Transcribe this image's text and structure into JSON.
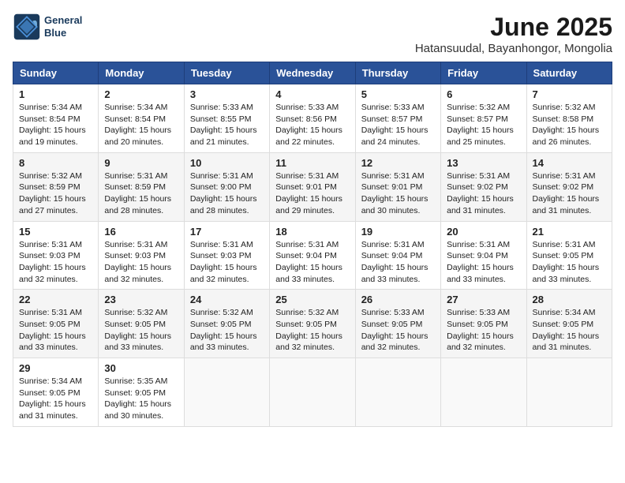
{
  "logo": {
    "line1": "General",
    "line2": "Blue"
  },
  "title": "June 2025",
  "subtitle": "Hatansuudal, Bayanhongor, Mongolia",
  "headers": [
    "Sunday",
    "Monday",
    "Tuesday",
    "Wednesday",
    "Thursday",
    "Friday",
    "Saturday"
  ],
  "weeks": [
    [
      {
        "day": "1",
        "sunrise": "Sunrise: 5:34 AM",
        "sunset": "Sunset: 8:54 PM",
        "daylight": "Daylight: 15 hours and 19 minutes."
      },
      {
        "day": "2",
        "sunrise": "Sunrise: 5:34 AM",
        "sunset": "Sunset: 8:54 PM",
        "daylight": "Daylight: 15 hours and 20 minutes."
      },
      {
        "day": "3",
        "sunrise": "Sunrise: 5:33 AM",
        "sunset": "Sunset: 8:55 PM",
        "daylight": "Daylight: 15 hours and 21 minutes."
      },
      {
        "day": "4",
        "sunrise": "Sunrise: 5:33 AM",
        "sunset": "Sunset: 8:56 PM",
        "daylight": "Daylight: 15 hours and 22 minutes."
      },
      {
        "day": "5",
        "sunrise": "Sunrise: 5:33 AM",
        "sunset": "Sunset: 8:57 PM",
        "daylight": "Daylight: 15 hours and 24 minutes."
      },
      {
        "day": "6",
        "sunrise": "Sunrise: 5:32 AM",
        "sunset": "Sunset: 8:57 PM",
        "daylight": "Daylight: 15 hours and 25 minutes."
      },
      {
        "day": "7",
        "sunrise": "Sunrise: 5:32 AM",
        "sunset": "Sunset: 8:58 PM",
        "daylight": "Daylight: 15 hours and 26 minutes."
      }
    ],
    [
      {
        "day": "8",
        "sunrise": "Sunrise: 5:32 AM",
        "sunset": "Sunset: 8:59 PM",
        "daylight": "Daylight: 15 hours and 27 minutes."
      },
      {
        "day": "9",
        "sunrise": "Sunrise: 5:31 AM",
        "sunset": "Sunset: 8:59 PM",
        "daylight": "Daylight: 15 hours and 28 minutes."
      },
      {
        "day": "10",
        "sunrise": "Sunrise: 5:31 AM",
        "sunset": "Sunset: 9:00 PM",
        "daylight": "Daylight: 15 hours and 28 minutes."
      },
      {
        "day": "11",
        "sunrise": "Sunrise: 5:31 AM",
        "sunset": "Sunset: 9:01 PM",
        "daylight": "Daylight: 15 hours and 29 minutes."
      },
      {
        "day": "12",
        "sunrise": "Sunrise: 5:31 AM",
        "sunset": "Sunset: 9:01 PM",
        "daylight": "Daylight: 15 hours and 30 minutes."
      },
      {
        "day": "13",
        "sunrise": "Sunrise: 5:31 AM",
        "sunset": "Sunset: 9:02 PM",
        "daylight": "Daylight: 15 hours and 31 minutes."
      },
      {
        "day": "14",
        "sunrise": "Sunrise: 5:31 AM",
        "sunset": "Sunset: 9:02 PM",
        "daylight": "Daylight: 15 hours and 31 minutes."
      }
    ],
    [
      {
        "day": "15",
        "sunrise": "Sunrise: 5:31 AM",
        "sunset": "Sunset: 9:03 PM",
        "daylight": "Daylight: 15 hours and 32 minutes."
      },
      {
        "day": "16",
        "sunrise": "Sunrise: 5:31 AM",
        "sunset": "Sunset: 9:03 PM",
        "daylight": "Daylight: 15 hours and 32 minutes."
      },
      {
        "day": "17",
        "sunrise": "Sunrise: 5:31 AM",
        "sunset": "Sunset: 9:03 PM",
        "daylight": "Daylight: 15 hours and 32 minutes."
      },
      {
        "day": "18",
        "sunrise": "Sunrise: 5:31 AM",
        "sunset": "Sunset: 9:04 PM",
        "daylight": "Daylight: 15 hours and 33 minutes."
      },
      {
        "day": "19",
        "sunrise": "Sunrise: 5:31 AM",
        "sunset": "Sunset: 9:04 PM",
        "daylight": "Daylight: 15 hours and 33 minutes."
      },
      {
        "day": "20",
        "sunrise": "Sunrise: 5:31 AM",
        "sunset": "Sunset: 9:04 PM",
        "daylight": "Daylight: 15 hours and 33 minutes."
      },
      {
        "day": "21",
        "sunrise": "Sunrise: 5:31 AM",
        "sunset": "Sunset: 9:05 PM",
        "daylight": "Daylight: 15 hours and 33 minutes."
      }
    ],
    [
      {
        "day": "22",
        "sunrise": "Sunrise: 5:31 AM",
        "sunset": "Sunset: 9:05 PM",
        "daylight": "Daylight: 15 hours and 33 minutes."
      },
      {
        "day": "23",
        "sunrise": "Sunrise: 5:32 AM",
        "sunset": "Sunset: 9:05 PM",
        "daylight": "Daylight: 15 hours and 33 minutes."
      },
      {
        "day": "24",
        "sunrise": "Sunrise: 5:32 AM",
        "sunset": "Sunset: 9:05 PM",
        "daylight": "Daylight: 15 hours and 33 minutes."
      },
      {
        "day": "25",
        "sunrise": "Sunrise: 5:32 AM",
        "sunset": "Sunset: 9:05 PM",
        "daylight": "Daylight: 15 hours and 32 minutes."
      },
      {
        "day": "26",
        "sunrise": "Sunrise: 5:33 AM",
        "sunset": "Sunset: 9:05 PM",
        "daylight": "Daylight: 15 hours and 32 minutes."
      },
      {
        "day": "27",
        "sunrise": "Sunrise: 5:33 AM",
        "sunset": "Sunset: 9:05 PM",
        "daylight": "Daylight: 15 hours and 32 minutes."
      },
      {
        "day": "28",
        "sunrise": "Sunrise: 5:34 AM",
        "sunset": "Sunset: 9:05 PM",
        "daylight": "Daylight: 15 hours and 31 minutes."
      }
    ],
    [
      {
        "day": "29",
        "sunrise": "Sunrise: 5:34 AM",
        "sunset": "Sunset: 9:05 PM",
        "daylight": "Daylight: 15 hours and 31 minutes."
      },
      {
        "day": "30",
        "sunrise": "Sunrise: 5:35 AM",
        "sunset": "Sunset: 9:05 PM",
        "daylight": "Daylight: 15 hours and 30 minutes."
      },
      {
        "day": "",
        "sunrise": "",
        "sunset": "",
        "daylight": ""
      },
      {
        "day": "",
        "sunrise": "",
        "sunset": "",
        "daylight": ""
      },
      {
        "day": "",
        "sunrise": "",
        "sunset": "",
        "daylight": ""
      },
      {
        "day": "",
        "sunrise": "",
        "sunset": "",
        "daylight": ""
      },
      {
        "day": "",
        "sunrise": "",
        "sunset": "",
        "daylight": ""
      }
    ]
  ]
}
